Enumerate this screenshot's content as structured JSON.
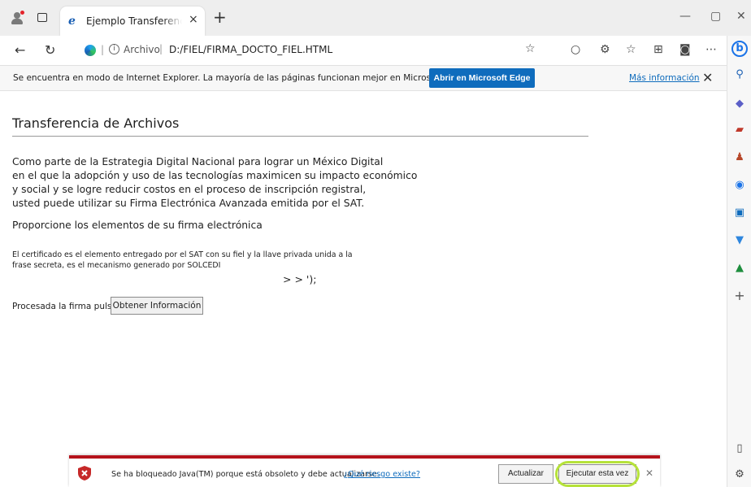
{
  "tab": {
    "title": "Ejemplo Transferencia de Archivos",
    "close_glyph": "×",
    "new_tab_glyph": "+"
  },
  "window": {
    "minimize_glyph": "—",
    "maximize_glyph": "▢",
    "close_glyph": "✕"
  },
  "address_bar": {
    "scheme_label": "Archivo",
    "url": "D:/FIEL/FIRMA_DOCTO_FIEL.HTML",
    "separator": "|",
    "info_glyph": "i"
  },
  "nav": {
    "back_glyph": "←",
    "refresh_glyph": "↻"
  },
  "ie_banner": {
    "message": "Se encuentra en modo de Internet Explorer. La mayoría de las páginas funcionan mejor en Microsoft Edge.",
    "open_button": "Abrir en Microsoft Edge",
    "more_info": "Más información",
    "close_glyph": "✕",
    "button_color": "#0f6cbd"
  },
  "page": {
    "title": "Transferencia de Archivos",
    "paragraph_lines": [
      "Como parte de la Estrategia Digital Nacional para lograr un México Digital",
      "en el que la adopción y uso de las tecnologías maximicen su impacto económico",
      "y social y se logre reducir costos en el proceso de inscripción registral,",
      "usted puede utilizar su Firma Electrónica Avanzada emitida por el SAT."
    ],
    "subtitle": "Proporcione los elementos de su firma electrónica",
    "note_lines": [
      "El certificado es el elemento entregado por el SAT con su fiel y la llave privada unida a la",
      "frase secreta, es el mecanismo generado por SOLCEDI"
    ],
    "stray_text": "> > ');",
    "process_label": "Procesada la firma pulse:",
    "get_info_button": "Obtener Información"
  },
  "java_notification": {
    "message": "Se ha bloqueado Java(TM) porque está obsoleto y debe actualizarse.",
    "risk_link": "¿Qué riesgo existe?",
    "update_button": "Actualizar",
    "run_once_button": "Ejecutar esta vez",
    "close_glyph": "✕",
    "accent_color": "#b5121b",
    "highlight_color": "#b6e23a"
  },
  "sidebar": {
    "bing_label": "b",
    "add_glyph": "+",
    "icons": [
      "search-icon",
      "tag-icon",
      "briefcase-icon",
      "people-icon",
      "office-icon",
      "outlook-icon",
      "tools-icon",
      "tree-icon"
    ]
  },
  "toolbar_icons": [
    "favorite-add-icon",
    "circle-icon",
    "extensions-icon",
    "favorites-icon",
    "collections-icon",
    "ie-mode-icon",
    "more-icon"
  ]
}
